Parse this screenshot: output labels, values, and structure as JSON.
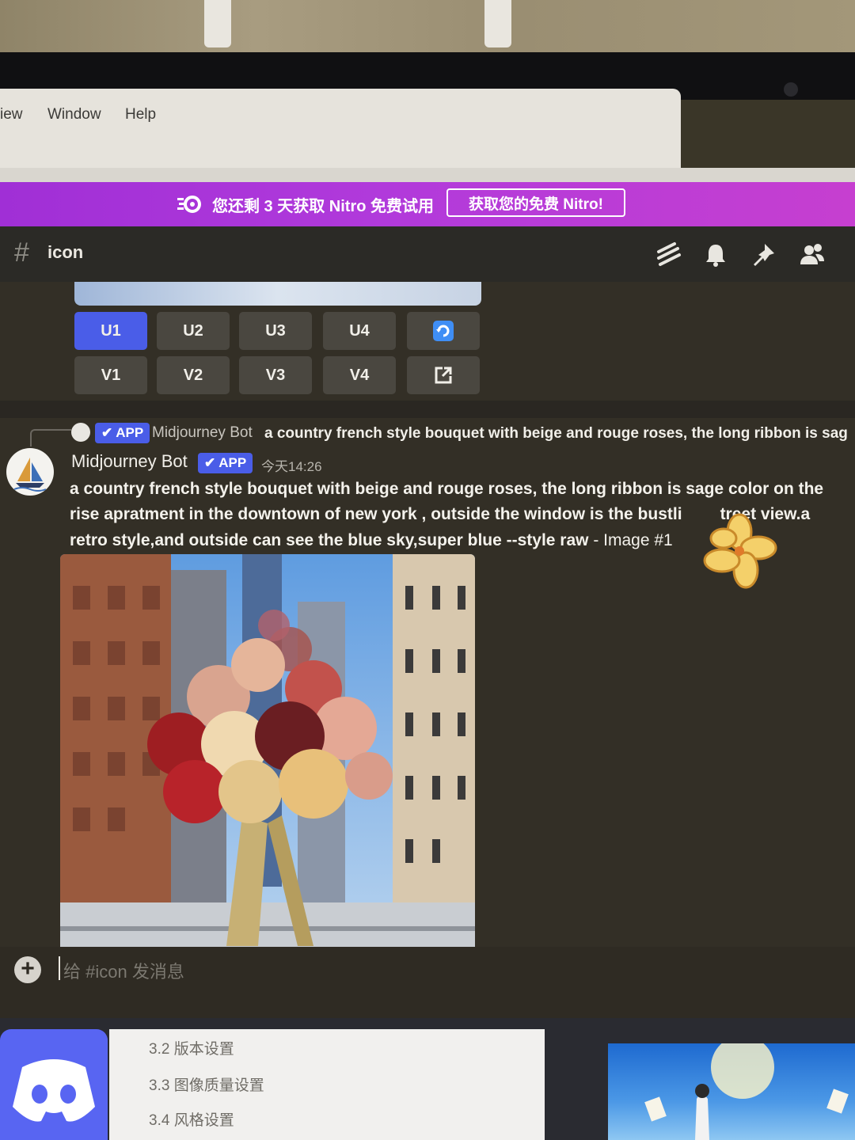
{
  "menubar": {
    "items": [
      "iew",
      "Window",
      "Help"
    ]
  },
  "nitro": {
    "message": "您还剩 3 天获取 Nitro 免费试用",
    "button_label": "获取您的免费 Nitro!"
  },
  "channel": {
    "name": "icon",
    "header_icons": [
      "threads-icon",
      "bell-icon",
      "pin-icon",
      "members-icon"
    ]
  },
  "buttons": {
    "row1": [
      "U1",
      "U2",
      "U3",
      "U4"
    ],
    "row2": [
      "V1",
      "V2",
      "V3",
      "V4"
    ]
  },
  "reply": {
    "badge": "APP",
    "name": "Midjourney Bot",
    "text": "a country french style bouquet with beige and rouge roses,  the long ribbon is sag"
  },
  "message": {
    "author": "Midjourney Bot",
    "badge": "APP",
    "timestamp": "今天14:26",
    "lines": [
      "a country french style bouquet with beige and rouge roses,  the long ribbon is sage color on the",
      "rise apratment in the downtown of new york ,  outside the window is the bustli",
      "retro style,and outside can see the blue sky,super blue --style raw"
    ],
    "line2_tail": "treet view.a",
    "suffix": " - Image #1"
  },
  "composer": {
    "placeholder": "给 #icon 发消息"
  },
  "doc": {
    "items": [
      "3.2 版本设置",
      "3.3 图像质量设置",
      "3.4 风格设置"
    ]
  },
  "colors": {
    "nitro": "#b13adb",
    "blurple": "#5865f2",
    "button_primary": "#4a5de8",
    "button": "#4a4740"
  }
}
